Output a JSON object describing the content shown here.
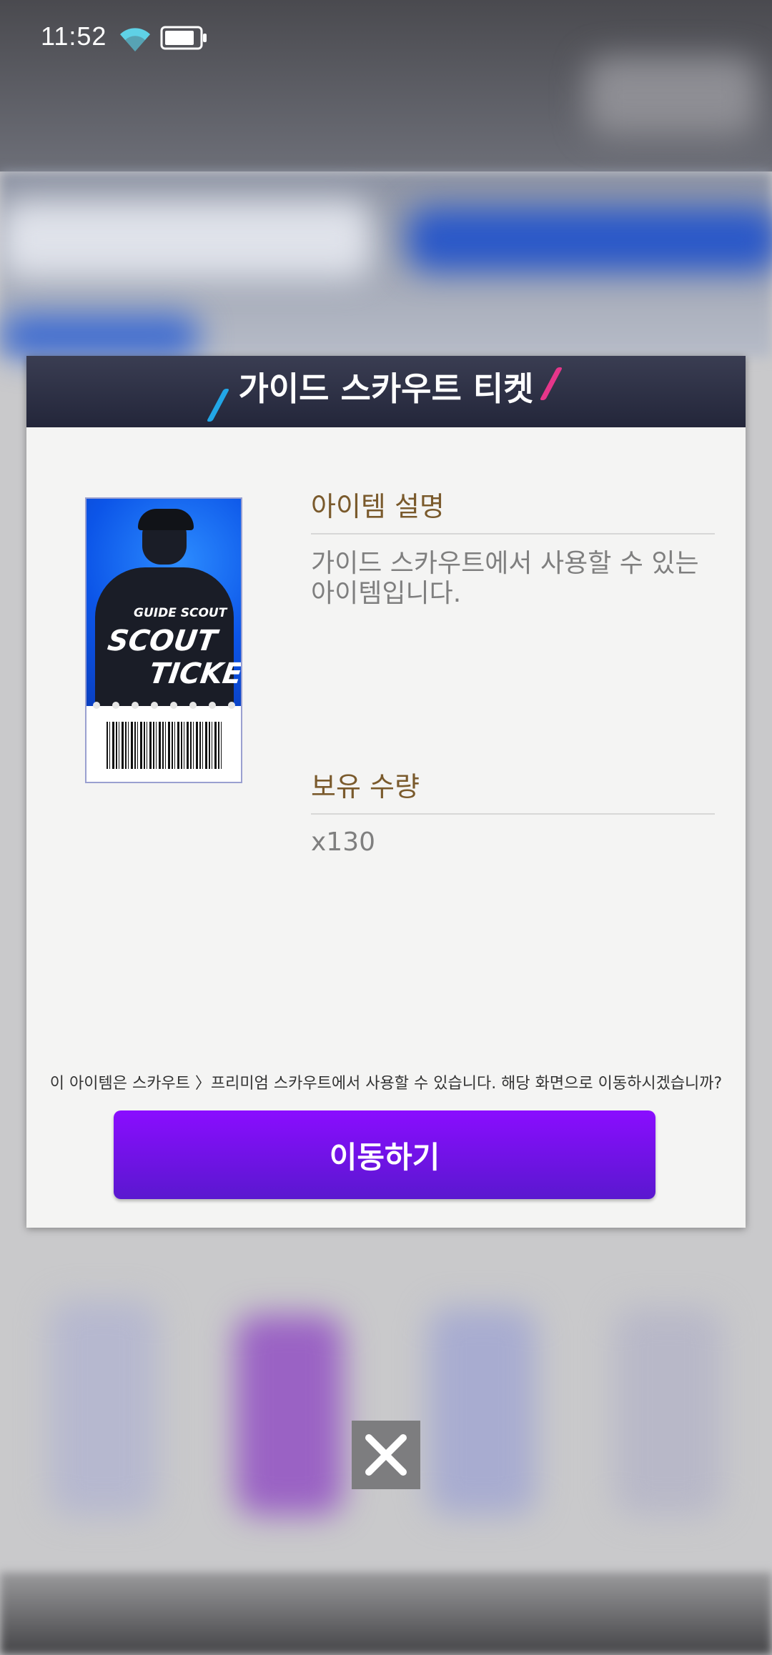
{
  "status_bar": {
    "time": "11:52"
  },
  "dialog": {
    "title": "가이드 스카우트 티켓",
    "item_image": {
      "tag": "GUIDE SCOUT",
      "line1": "SCOUT",
      "line2": "TICKET"
    },
    "description_label": "아이템 설명",
    "description_text": "가이드 스카우트에서 사용할 수 있는 아이템입니다.",
    "quantity_label": "보유 수량",
    "quantity_value": "x130",
    "notice": "이 아이템은 스카우트 〉프리미엄 스카우트에서 사용할 수 있습니다. 해당 화면으로 이동하시겠습니까?",
    "move_button_label": "이동하기"
  },
  "icons": {
    "wifi": "wifi-icon",
    "battery": "battery-icon",
    "close": "close-icon"
  },
  "colors": {
    "header_bg": "#2a2d42",
    "accent_blue": "#22a6e6",
    "accent_pink": "#e5368a",
    "button_purple": "#7a12f0",
    "label_brown": "#7a5a2c"
  }
}
